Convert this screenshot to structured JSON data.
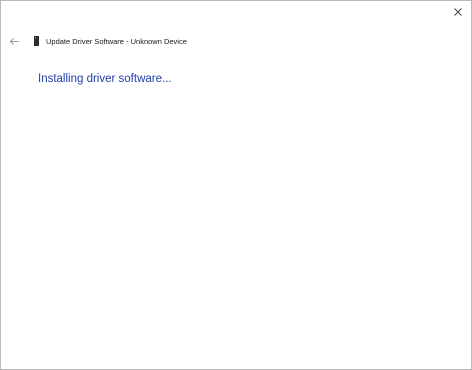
{
  "window": {
    "title": "Update Driver Software - Unknown Device",
    "close_icon": "close-icon",
    "back_icon": "back-arrow-icon",
    "device_icon": "device-icon"
  },
  "main": {
    "status": "Installing driver software..."
  },
  "colors": {
    "status_text": "#1f3ea8",
    "border": "#b9b9b9"
  }
}
